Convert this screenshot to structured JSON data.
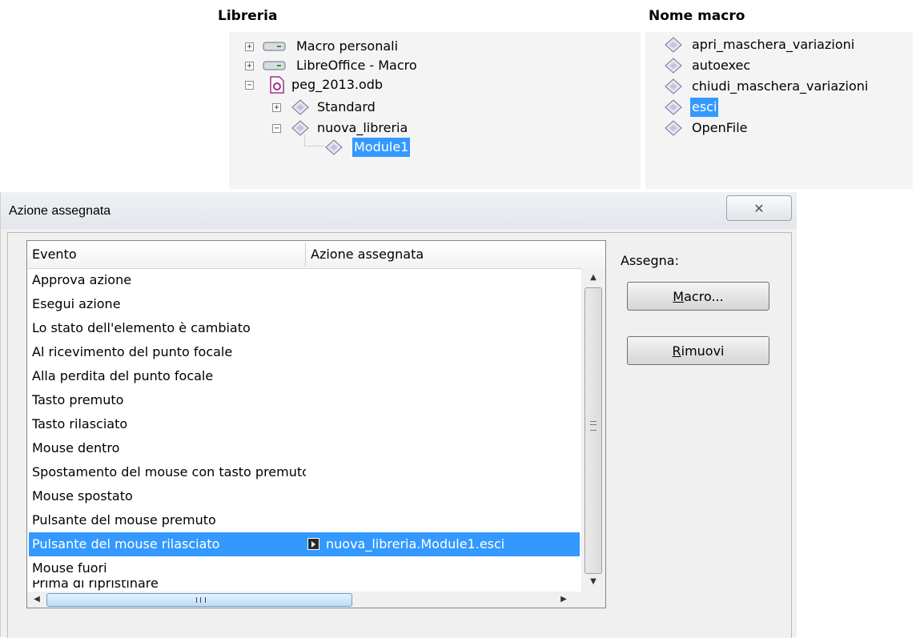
{
  "library_panel": {
    "title": "Libreria",
    "items": [
      {
        "label": "Macro personali"
      },
      {
        "label": "LibreOffice - Macro"
      },
      {
        "label": "peg_2013.odb"
      },
      {
        "label": "Standard"
      },
      {
        "label": "nuova_libreria"
      },
      {
        "label": "Module1"
      }
    ]
  },
  "macro_panel": {
    "title": "Nome macro",
    "items": [
      {
        "label": "apri_maschera_variazioni"
      },
      {
        "label": "autoexec"
      },
      {
        "label": "chiudi_maschera_variazioni"
      },
      {
        "label": "esci"
      },
      {
        "label": "OpenFile"
      }
    ]
  },
  "dialog": {
    "title": "Azione assegnata",
    "close_glyph": "✕",
    "table": {
      "columns": [
        "Evento",
        "Azione assegnata"
      ],
      "rows": [
        {
          "event": "Approva azione",
          "action": ""
        },
        {
          "event": "Esegui azione",
          "action": ""
        },
        {
          "event": "Lo stato dell'elemento è cambiato",
          "action": ""
        },
        {
          "event": "Al ricevimento del punto focale",
          "action": ""
        },
        {
          "event": "Alla perdita del punto focale",
          "action": ""
        },
        {
          "event": "Tasto premuto",
          "action": ""
        },
        {
          "event": "Tasto rilasciato",
          "action": ""
        },
        {
          "event": "Mouse dentro",
          "action": ""
        },
        {
          "event": "Spostamento del mouse con tasto premuto",
          "action": ""
        },
        {
          "event": "Mouse spostato",
          "action": ""
        },
        {
          "event": "Pulsante del mouse premuto",
          "action": ""
        },
        {
          "event": "Pulsante del mouse rilasciato",
          "action": "nuova_libreria.Module1.esci"
        },
        {
          "event": "Mouse fuori",
          "action": ""
        },
        {
          "event": "Prima di ripristinare",
          "action": ""
        }
      ]
    },
    "assign_label": "Assegna:",
    "buttons": {
      "macro_first": "M",
      "macro_rest": "acro...",
      "remove_first": "R",
      "remove_rest": "imuovi"
    },
    "scroll_glyphs": {
      "up": "▲",
      "down": "▼",
      "left": "◀",
      "right": "▶"
    }
  },
  "colors": {
    "selection": "#3399ff"
  }
}
